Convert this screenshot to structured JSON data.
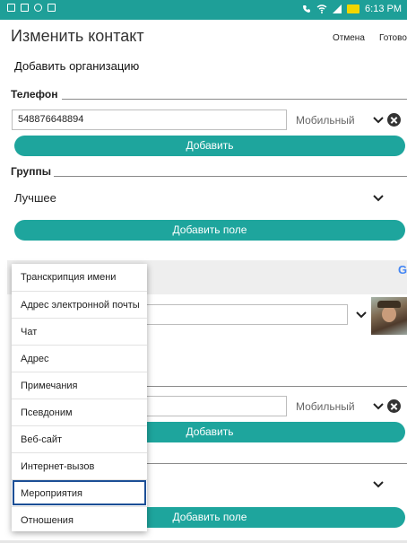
{
  "status_bar": {
    "time": "6:13 PM"
  },
  "header": {
    "title": "Изменить контакт",
    "cancel_label": "Отмена",
    "done_label": "Готово"
  },
  "organization": {
    "add_label": "Добавить организацию"
  },
  "phone": {
    "section_label": "Телефон",
    "number": "548876648894",
    "type": "Мобильный",
    "add_label": "Добавить"
  },
  "groups": {
    "section_label": "Группы",
    "value": "Лучшее",
    "add_field_label": "Добавить поле"
  },
  "google_account": {
    "logo_letter": "G"
  },
  "background_rows": {
    "phone_type": "Мобильный",
    "add_label": "Добавить",
    "add_field_label": "Добавить поле"
  },
  "field_menu": {
    "items": [
      "Транскрипция имени",
      "Адрес электронной почты",
      "Чат",
      "Адрес",
      "Примечания",
      "Псевдоним",
      "Веб-сайт",
      "Интернет-вызов",
      "Мероприятия",
      "Отношения"
    ],
    "selected_index": 8
  },
  "colors": {
    "accent": "#1ea59d",
    "status_bar": "#1e9f98",
    "selection_outline": "#1c4f96"
  }
}
